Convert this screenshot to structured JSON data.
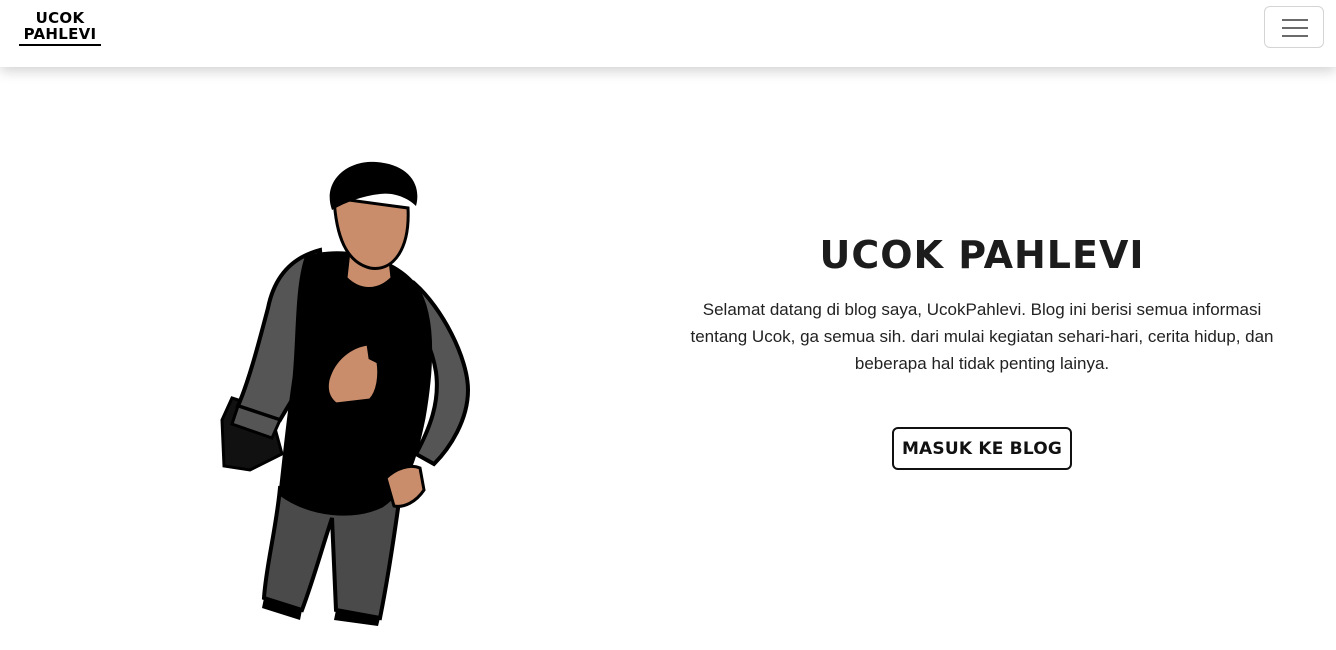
{
  "navbar": {
    "brand_line1": "UCOK",
    "brand_line2": "PAHLEVI",
    "menu_icon": "hamburger-menu-icon"
  },
  "hero": {
    "title": "UCOK PAHLEVI",
    "description": "Selamat datang di blog saya, UcokPahlevi. Blog ini berisi semua informasi tentang Ucok, ga semua sih. dari mulai kegiatan sehari-hari, cerita hidup, dan beberapa hal tidak penting lainya.",
    "button_label": "MASUK KE BLOG",
    "illustration": "person-illustration"
  },
  "colors": {
    "background": "#ffffff",
    "text": "#1c1c1c",
    "skin": "#c98d6c",
    "shirt": "#000000",
    "jacket": "#555555",
    "pants": "#4a4a4a"
  }
}
